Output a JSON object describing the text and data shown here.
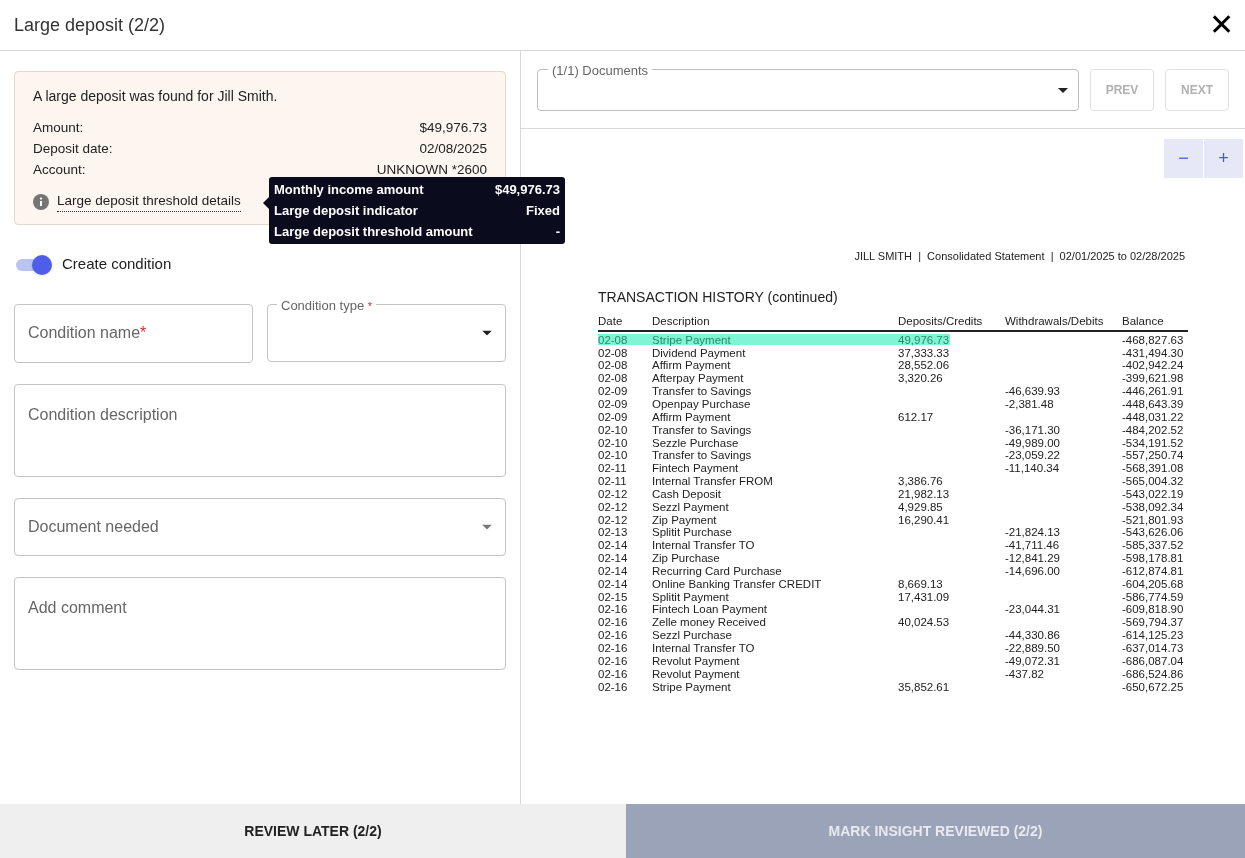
{
  "window": {
    "title": "Large deposit (2/2)",
    "close": "✕"
  },
  "notice": {
    "message": "A large deposit was found for Jill Smith.",
    "details": [
      {
        "label": "Amount:",
        "value": "$49,976.73"
      },
      {
        "label": "Deposit date:",
        "value": "02/08/2025"
      },
      {
        "label": "Account:",
        "value": "UNKNOWN *2600"
      }
    ],
    "link": "Large deposit threshold details"
  },
  "tooltip": {
    "rows": [
      {
        "label": "Monthly income amount",
        "value": "$49,976.73"
      },
      {
        "label": "Large deposit indicator",
        "value": "Fixed"
      },
      {
        "label": "Large deposit threshold amount",
        "value": "-"
      }
    ]
  },
  "create_condition": {
    "label": "Create condition",
    "on": true
  },
  "fields": [
    {
      "kind": "text",
      "placeholder": "Condition name",
      "required_mark": "*"
    },
    {
      "kind": "select",
      "label": "Condition type",
      "required_mark": "*"
    },
    {
      "kind": "textarea",
      "placeholder": "Condition description"
    },
    {
      "kind": "select-placeholder",
      "placeholder": "Document needed"
    },
    {
      "kind": "textarea",
      "placeholder": "Add comment"
    }
  ],
  "documents": {
    "label": "(1/1) Documents",
    "prev": {
      "label": "PREV",
      "disabled": true
    },
    "next": {
      "label": "NEXT",
      "disabled": true
    }
  },
  "zoom": {
    "out": "−",
    "in": "+"
  },
  "statement": {
    "header": "JILL SMITH  |  Consolidated Statement  |  02/01/2025 to 02/28/2025",
    "title": "TRANSACTION HISTORY (continued)",
    "columns": [
      "Date",
      "Description",
      "Deposits/Credits",
      "Withdrawals/Debits",
      "Balance"
    ],
    "rows": [
      {
        "cells": [
          "02-08",
          "Stripe Payment",
          "49,976.73",
          "",
          "-468,827.63"
        ],
        "highlighted": true
      },
      {
        "cells": [
          "02-08",
          "Dividend Payment",
          "37,333.33",
          "",
          "-431,494.30"
        ],
        "highlighted": false
      },
      {
        "cells": [
          "02-08",
          "Affirm Payment",
          "28,552.06",
          "",
          "-402,942.24"
        ],
        "highlighted": false
      },
      {
        "cells": [
          "02-08",
          "Afterpay Payment",
          "3,320.26",
          "",
          "-399,621.98"
        ],
        "highlighted": false
      },
      {
        "cells": [
          "02-09",
          "Transfer to Savings",
          "",
          "-46,639.93",
          "-446,261.91"
        ],
        "highlighted": false
      },
      {
        "cells": [
          "02-09",
          "Openpay Purchase",
          "",
          "-2,381.48",
          "-448,643.39"
        ],
        "highlighted": false
      },
      {
        "cells": [
          "02-09",
          "Affirm Payment",
          "612.17",
          "",
          "-448,031.22"
        ],
        "highlighted": false
      },
      {
        "cells": [
          "02-10",
          "Transfer to Savings",
          "",
          "-36,171.30",
          "-484,202.52"
        ],
        "highlighted": false
      },
      {
        "cells": [
          "02-10",
          "Sezzle Purchase",
          "",
          "-49,989.00",
          "-534,191.52"
        ],
        "highlighted": false
      },
      {
        "cells": [
          "02-10",
          "Transfer to Savings",
          "",
          "-23,059.22",
          "-557,250.74"
        ],
        "highlighted": false
      },
      {
        "cells": [
          "02-11",
          "Fintech Payment",
          "",
          "-11,140.34",
          "-568,391.08"
        ],
        "highlighted": false
      },
      {
        "cells": [
          "02-11",
          "Internal Transfer FROM",
          "3,386.76",
          "",
          "-565,004.32"
        ],
        "highlighted": false
      },
      {
        "cells": [
          "02-12",
          "Cash Deposit",
          "21,982.13",
          "",
          "-543,022.19"
        ],
        "highlighted": false
      },
      {
        "cells": [
          "02-12",
          "Sezzl Payment",
          "4,929.85",
          "",
          "-538,092.34"
        ],
        "highlighted": false
      },
      {
        "cells": [
          "02-12",
          "Zip Payment",
          "16,290.41",
          "",
          "-521,801.93"
        ],
        "highlighted": false
      },
      {
        "cells": [
          "02-13",
          "Splitit Purchase",
          "",
          "-21,824.13",
          "-543,626.06"
        ],
        "highlighted": false
      },
      {
        "cells": [
          "02-14",
          "Internal Transfer TO",
          "",
          "-41,711.46",
          "-585,337.52"
        ],
        "highlighted": false
      },
      {
        "cells": [
          "02-14",
          "Zip Purchase",
          "",
          "-12,841.29",
          "-598,178.81"
        ],
        "highlighted": false
      },
      {
        "cells": [
          "02-14",
          "Recurring Card Purchase",
          "",
          "-14,696.00",
          "-612,874.81"
        ],
        "highlighted": false
      },
      {
        "cells": [
          "02-14",
          "Online Banking Transfer CREDIT",
          "8,669.13",
          "",
          "-604,205.68"
        ],
        "highlighted": false
      },
      {
        "cells": [
          "02-15",
          "Splitit Payment",
          "17,431.09",
          "",
          "-586,774.59"
        ],
        "highlighted": false
      },
      {
        "cells": [
          "02-16",
          "Fintech Loan Payment",
          "",
          "-23,044.31",
          "-609,818.90"
        ],
        "highlighted": false
      },
      {
        "cells": [
          "02-16",
          "Zelle money Received",
          "40,024.53",
          "",
          "-569,794.37"
        ],
        "highlighted": false
      },
      {
        "cells": [
          "02-16",
          "Sezzl Purchase",
          "",
          "-44,330.86",
          "-614,125.23"
        ],
        "highlighted": false
      },
      {
        "cells": [
          "02-16",
          "Internal Transfer TO",
          "",
          "-22,889.50",
          "-637,014.73"
        ],
        "highlighted": false
      },
      {
        "cells": [
          "02-16",
          "Revolut Payment",
          "",
          "-49,072.31",
          "-686,087.04"
        ],
        "highlighted": false
      },
      {
        "cells": [
          "02-16",
          "Revolut Payment",
          "",
          "-437.82",
          "-686,524.86"
        ],
        "highlighted": false
      },
      {
        "cells": [
          "02-16",
          "Stripe Payment",
          "35,852.61",
          "",
          "-650,672.25"
        ],
        "highlighted": false
      }
    ]
  },
  "footer": {
    "review_later": {
      "label": "REVIEW LATER (2/2)",
      "disabled": false
    },
    "mark_reviewed": {
      "label": "MARK INSIGHT REVIEWED (2/2)",
      "disabled": true
    }
  }
}
